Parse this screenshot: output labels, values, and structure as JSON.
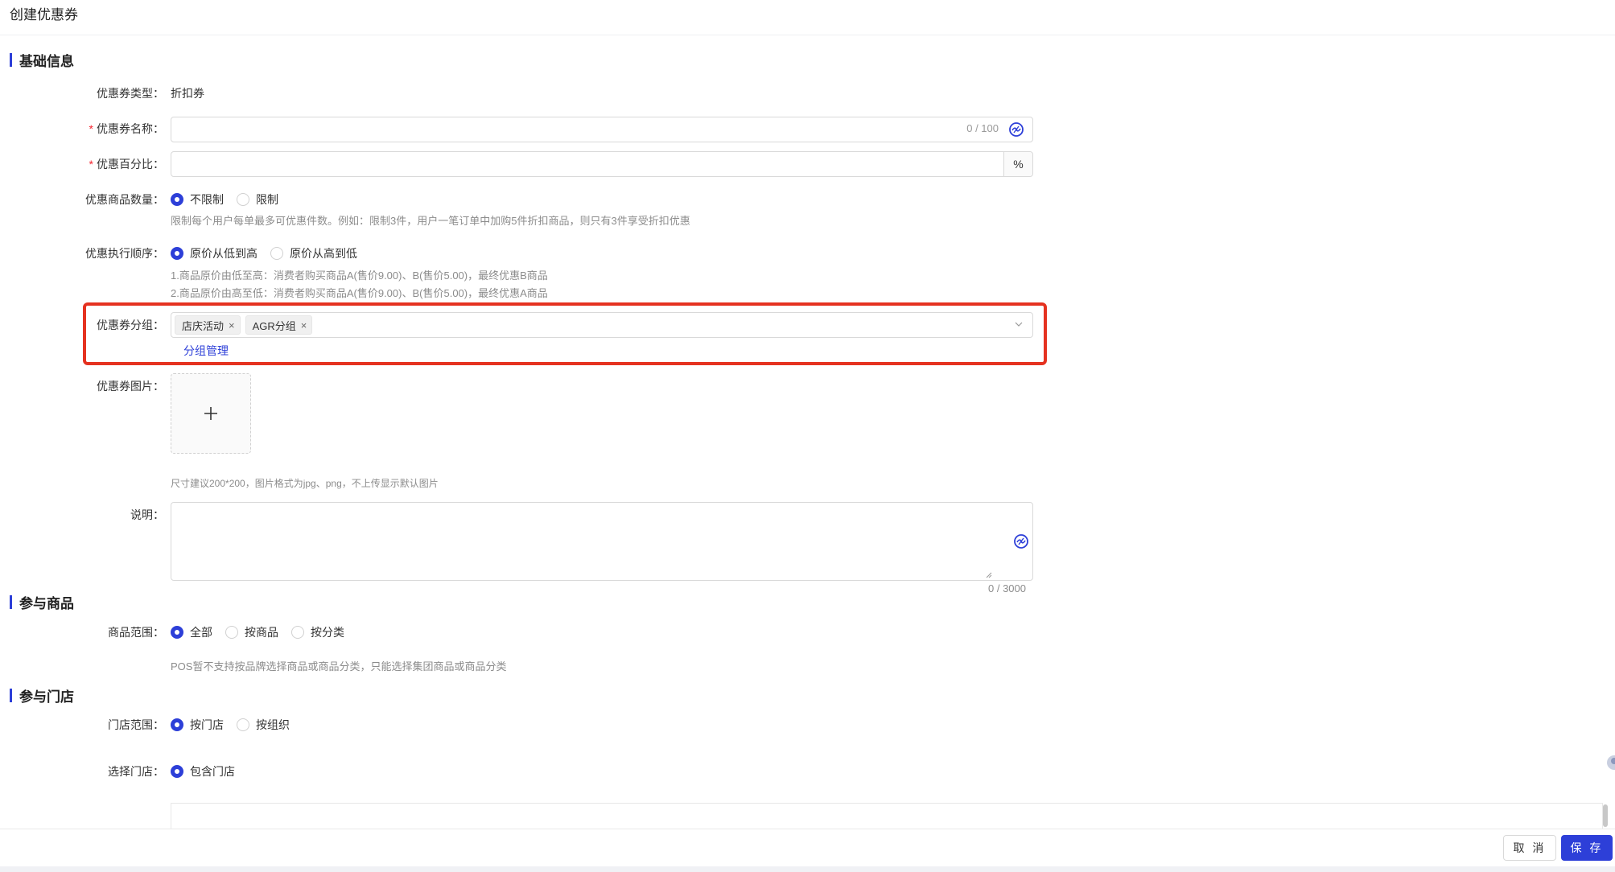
{
  "page": {
    "title": "创建优惠券"
  },
  "sections": {
    "basic": "基础信息",
    "goods": "参与商品",
    "stores": "参与门店"
  },
  "basic": {
    "type_label": "优惠券类型",
    "type_value": "折扣券",
    "name_label": "优惠券名称",
    "name_value": "",
    "name_counter": "0 / 100",
    "percent_label": "优惠百分比",
    "percent_value": "",
    "percent_suffix": "%",
    "qty_label": "优惠商品数量",
    "qty_options": [
      "不限制",
      "限制"
    ],
    "qty_selected": "不限制",
    "qty_hint": "限制每个用户每单最多可优惠件数。例如：限制3件，用户一笔订单中加购5件折扣商品，则只有3件享受折扣优惠",
    "order_label": "优惠执行顺序",
    "order_options": [
      "原价从低到高",
      "原价从高到低"
    ],
    "order_selected": "原价从低到高",
    "order_hint_1": "1.商品原价由低至高：消费者购买商品A(售价9.00)、B(售价5.00)，最终优惠B商品",
    "order_hint_2": "2.商品原价由高至低：消费者购买商品A(售价9.00)、B(售价5.00)，最终优惠A商品",
    "group_label": "优惠券分组",
    "group_tags": [
      "店庆活动",
      "AGR分组"
    ],
    "group_manage": "分组管理",
    "image_label": "优惠券图片",
    "image_hint": "尺寸建议200*200，图片格式为jpg、png，不上传显示默认图片",
    "desc_label": "说明",
    "desc_value": "",
    "desc_counter": "0 / 3000"
  },
  "goods": {
    "scope_label": "商品范围",
    "scope_options": [
      "全部",
      "按商品",
      "按分类"
    ],
    "scope_selected": "全部",
    "scope_hint": "POS暂不支持按品牌选择商品或商品分类，只能选择集团商品或商品分类"
  },
  "stores": {
    "scope_label": "门店范围",
    "scope_options": [
      "按门店",
      "按组织"
    ],
    "scope_selected": "按门店",
    "select_label": "选择门店",
    "select_options": [
      "包含门店"
    ],
    "select_selected": "包含门店"
  },
  "footer": {
    "cancel": "取 消",
    "save": "保 存"
  },
  "colors": {
    "primary": "#2d3fd8",
    "required": "#f5222d",
    "highlight": "#e53220"
  },
  "icons": {
    "ai": "ai-assist-icon",
    "chevron": "chevron-down-icon",
    "tag_close": "close-icon",
    "upload": "plus-icon"
  }
}
